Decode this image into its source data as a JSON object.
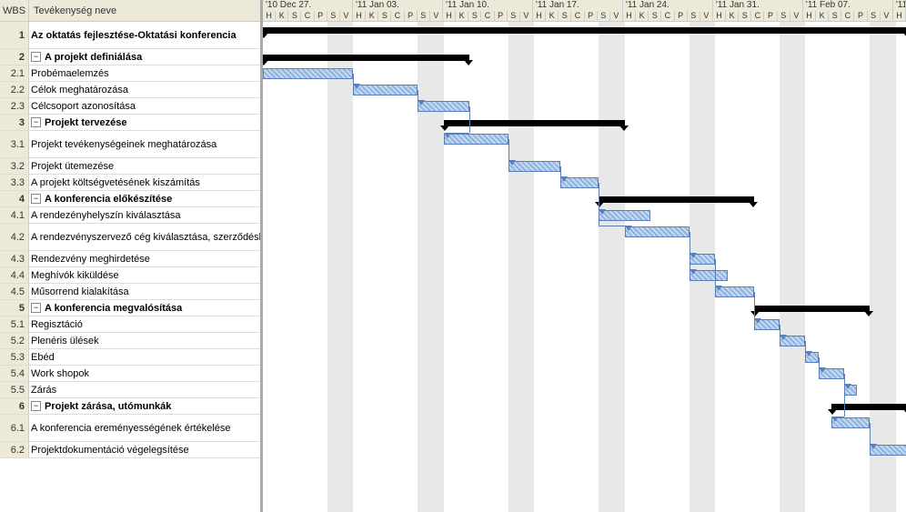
{
  "columns": {
    "wbs": "WBS",
    "name": "Tevékenység neve"
  },
  "timeline": {
    "startDay": 0,
    "dayWidth": 14.2,
    "weeks": [
      {
        "label": "'10 Dec 27.",
        "days": 7
      },
      {
        "label": "'11 Jan 03.",
        "days": 7
      },
      {
        "label": "'11 Jan 10.",
        "days": 7
      },
      {
        "label": "'11 Jan 17.",
        "days": 7
      },
      {
        "label": "'11 Jan 24.",
        "days": 7
      },
      {
        "label": "'11 Jan 31.",
        "days": 7
      },
      {
        "label": "'11 Feb 07.",
        "days": 7
      },
      {
        "label": "'11",
        "days": 1
      }
    ],
    "dayLabels": [
      "H",
      "K",
      "S",
      "C",
      "P",
      "S",
      "V"
    ],
    "weekendOffsets": [
      5,
      6,
      12,
      13,
      19,
      20,
      26,
      27,
      33,
      34,
      40,
      41,
      47,
      48
    ]
  },
  "tasks": [
    {
      "wbs": "1",
      "name": "Az oktatás fejlesztése-Oktatási konferencia",
      "level": 0,
      "type": "summary",
      "height": 30,
      "start": 0,
      "end": 50
    },
    {
      "wbs": "2",
      "name": "A projekt definiálása",
      "level": 1,
      "type": "summary",
      "height": 18,
      "start": 0,
      "end": 16
    },
    {
      "wbs": "2.1",
      "name": "Probémaelemzés",
      "level": 2,
      "type": "task",
      "height": 18,
      "start": 0,
      "end": 7
    },
    {
      "wbs": "2.2",
      "name": "Célok meghatározása",
      "level": 2,
      "type": "task",
      "height": 18,
      "start": 7,
      "end": 12
    },
    {
      "wbs": "2.3",
      "name": "Célcsoport azonosítása",
      "level": 2,
      "type": "task",
      "height": 18,
      "start": 12,
      "end": 16
    },
    {
      "wbs": "3",
      "name": "Projekt tervezése",
      "level": 1,
      "type": "summary",
      "height": 18,
      "start": 14,
      "end": 28
    },
    {
      "wbs": "3.1",
      "name": "Projekt tevékenységeinek meghatározása",
      "level": 2,
      "type": "task",
      "height": 30,
      "start": 14,
      "end": 19
    },
    {
      "wbs": "3.2",
      "name": "Projekt ütemezése",
      "level": 2,
      "type": "task",
      "height": 18,
      "start": 19,
      "end": 23
    },
    {
      "wbs": "3.3",
      "name": "A projekt költségvetésének kiszámítás",
      "level": 2,
      "type": "task",
      "height": 18,
      "start": 23,
      "end": 26
    },
    {
      "wbs": "4",
      "name": "A konferencia előkészítése",
      "level": 1,
      "type": "summary",
      "height": 18,
      "start": 26,
      "end": 38
    },
    {
      "wbs": "4.1",
      "name": "A rendezényhelyszín kiválasztása",
      "level": 2,
      "type": "task",
      "height": 18,
      "start": 26,
      "end": 30
    },
    {
      "wbs": "4.2",
      "name": "A rendezvényszervező cég kiválasztása, szerződéskötés",
      "level": 2,
      "type": "task",
      "height": 30,
      "start": 28,
      "end": 33
    },
    {
      "wbs": "4.3",
      "name": "Rendezvény meghirdetése",
      "level": 2,
      "type": "task",
      "height": 18,
      "start": 33,
      "end": 35
    },
    {
      "wbs": "4.4",
      "name": "Meghívók kiküldése",
      "level": 2,
      "type": "task",
      "height": 18,
      "start": 33,
      "end": 36
    },
    {
      "wbs": "4.5",
      "name": "Műsorrend kialakítása",
      "level": 2,
      "type": "task",
      "height": 18,
      "start": 35,
      "end": 38
    },
    {
      "wbs": "5",
      "name": "A konferencia megvalósítása",
      "level": 1,
      "type": "summary",
      "height": 18,
      "start": 38,
      "end": 47
    },
    {
      "wbs": "5.1",
      "name": "Regisztáció",
      "level": 2,
      "type": "task",
      "height": 18,
      "start": 38,
      "end": 40
    },
    {
      "wbs": "5.2",
      "name": "Plenéris ülések",
      "level": 2,
      "type": "task",
      "height": 18,
      "start": 40,
      "end": 42
    },
    {
      "wbs": "5.3",
      "name": "Ebéd",
      "level": 2,
      "type": "task",
      "height": 18,
      "start": 42,
      "end": 43
    },
    {
      "wbs": "5.4",
      "name": "Work shopok",
      "level": 2,
      "type": "task",
      "height": 18,
      "start": 43,
      "end": 45
    },
    {
      "wbs": "5.5",
      "name": "Zárás",
      "level": 2,
      "type": "task",
      "height": 18,
      "start": 45,
      "end": 46
    },
    {
      "wbs": "6",
      "name": "Projekt zárása, utómunkák",
      "level": 1,
      "type": "summary",
      "height": 18,
      "start": 44,
      "end": 50
    },
    {
      "wbs": "6.1",
      "name": "A konferencia ereményességének értékelése",
      "level": 2,
      "type": "task",
      "height": 30,
      "start": 44,
      "end": 47
    },
    {
      "wbs": "6.2",
      "name": "Projektdokumentáció végelegsítése",
      "level": 2,
      "type": "task",
      "height": 18,
      "start": 47,
      "end": 50
    }
  ],
  "links": [
    {
      "from": 2,
      "to": 3
    },
    {
      "from": 3,
      "to": 4
    },
    {
      "from": 4,
      "to": 6
    },
    {
      "from": 6,
      "to": 7
    },
    {
      "from": 7,
      "to": 8
    },
    {
      "from": 8,
      "to": 10
    },
    {
      "from": 8,
      "to": 11
    },
    {
      "from": 11,
      "to": 12
    },
    {
      "from": 11,
      "to": 13
    },
    {
      "from": 12,
      "to": 14
    },
    {
      "from": 14,
      "to": 16
    },
    {
      "from": 16,
      "to": 17
    },
    {
      "from": 17,
      "to": 18
    },
    {
      "from": 18,
      "to": 19
    },
    {
      "from": 19,
      "to": 20
    },
    {
      "from": 19,
      "to": 22
    },
    {
      "from": 22,
      "to": 23
    }
  ],
  "chart_data": {
    "type": "gantt",
    "title": "",
    "date_range": [
      "2010-12-27",
      "2011-02-14"
    ],
    "tasks": [
      {
        "wbs": "1",
        "name": "Az oktatás fejlesztése-Oktatási konferencia",
        "type": "summary",
        "start": "2010-12-27",
        "end": "2011-02-14"
      },
      {
        "wbs": "2",
        "name": "A projekt definiálása",
        "type": "summary",
        "start": "2010-12-27",
        "end": "2011-01-12"
      },
      {
        "wbs": "2.1",
        "name": "Probémaelemzés",
        "type": "task",
        "start": "2010-12-27",
        "end": "2011-01-03"
      },
      {
        "wbs": "2.2",
        "name": "Célok meghatározása",
        "type": "task",
        "start": "2011-01-03",
        "end": "2011-01-08"
      },
      {
        "wbs": "2.3",
        "name": "Célcsoport azonosítása",
        "type": "task",
        "start": "2011-01-08",
        "end": "2011-01-12"
      },
      {
        "wbs": "3",
        "name": "Projekt tervezése",
        "type": "summary",
        "start": "2011-01-10",
        "end": "2011-01-24"
      },
      {
        "wbs": "3.1",
        "name": "Projekt tevékenységeinek meghatározása",
        "type": "task",
        "start": "2011-01-10",
        "end": "2011-01-15"
      },
      {
        "wbs": "3.2",
        "name": "Projekt ütemezése",
        "type": "task",
        "start": "2011-01-15",
        "end": "2011-01-19"
      },
      {
        "wbs": "3.3",
        "name": "A projekt költségvetésének kiszámítás",
        "type": "task",
        "start": "2011-01-19",
        "end": "2011-01-22"
      },
      {
        "wbs": "4",
        "name": "A konferencia előkészítése",
        "type": "summary",
        "start": "2011-01-22",
        "end": "2011-02-03"
      },
      {
        "wbs": "4.1",
        "name": "A rendezényhelyszín kiválasztása",
        "type": "task",
        "start": "2011-01-22",
        "end": "2011-01-26"
      },
      {
        "wbs": "4.2",
        "name": "A rendezvényszervező cég kiválasztása, szerződéskötés",
        "type": "task",
        "start": "2011-01-24",
        "end": "2011-01-29"
      },
      {
        "wbs": "4.3",
        "name": "Rendezvény meghirdetése",
        "type": "task",
        "start": "2011-01-29",
        "end": "2011-01-31"
      },
      {
        "wbs": "4.4",
        "name": "Meghívók kiküldése",
        "type": "task",
        "start": "2011-01-29",
        "end": "2011-02-01"
      },
      {
        "wbs": "4.5",
        "name": "Műsorrend kialakítása",
        "type": "task",
        "start": "2011-01-31",
        "end": "2011-02-03"
      },
      {
        "wbs": "5",
        "name": "A konferencia megvalósítása",
        "type": "summary",
        "start": "2011-02-03",
        "end": "2011-02-12"
      },
      {
        "wbs": "5.1",
        "name": "Regisztáció",
        "type": "task",
        "start": "2011-02-03",
        "end": "2011-02-05"
      },
      {
        "wbs": "5.2",
        "name": "Plenéris ülések",
        "type": "task",
        "start": "2011-02-05",
        "end": "2011-02-07"
      },
      {
        "wbs": "5.3",
        "name": "Ebéd",
        "type": "task",
        "start": "2011-02-07",
        "end": "2011-02-08"
      },
      {
        "wbs": "5.4",
        "name": "Work shopok",
        "type": "task",
        "start": "2011-02-08",
        "end": "2011-02-10"
      },
      {
        "wbs": "5.5",
        "name": "Zárás",
        "type": "task",
        "start": "2011-02-10",
        "end": "2011-02-11"
      },
      {
        "wbs": "6",
        "name": "Projekt zárása, utómunkák",
        "type": "summary",
        "start": "2011-02-09",
        "end": "2011-02-14"
      },
      {
        "wbs": "6.1",
        "name": "A konferencia ereményességének értékelése",
        "type": "task",
        "start": "2011-02-09",
        "end": "2011-02-12"
      },
      {
        "wbs": "6.2",
        "name": "Projektdokumentáció végelegsítése",
        "type": "task",
        "start": "2011-02-12",
        "end": "2011-02-14"
      }
    ]
  }
}
